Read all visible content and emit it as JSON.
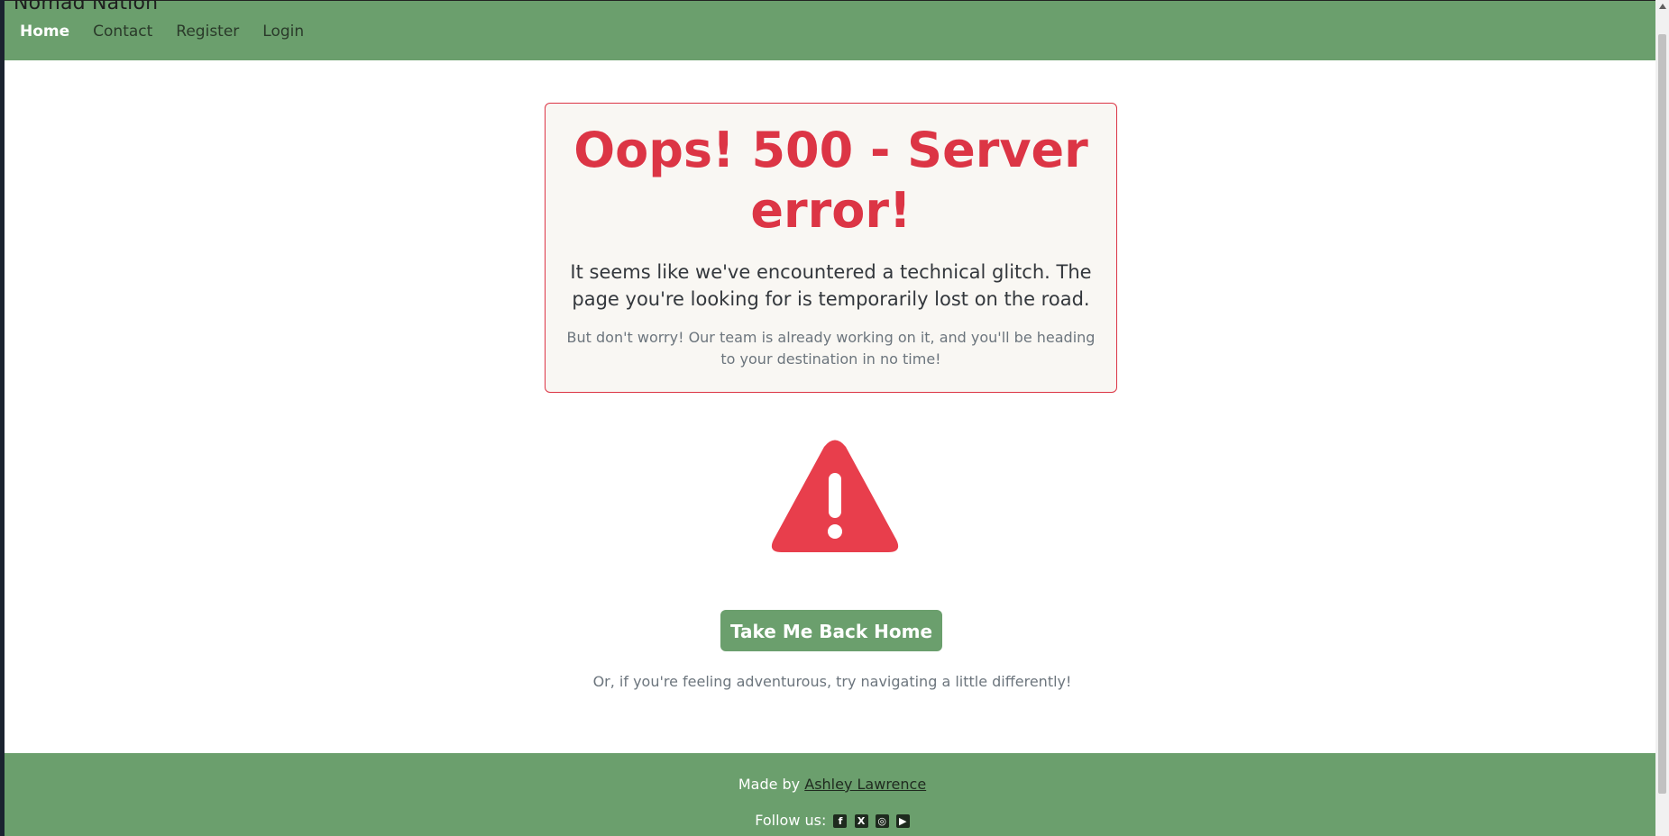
{
  "brand": "Nomad Nation",
  "nav": {
    "items": [
      {
        "label": "Home",
        "active": true
      },
      {
        "label": "Contact",
        "active": false
      },
      {
        "label": "Register",
        "active": false
      },
      {
        "label": "Login",
        "active": false
      }
    ]
  },
  "error_card": {
    "title": "Oops! 500 - Server error!",
    "lead": "It seems like we've encountered a technical glitch. The page you're looking for is temporarily lost on the road.",
    "sub": "But don't worry! Our team is already working on it, and you'll be heading to your destination in no time!"
  },
  "warning_icon": "warning-triangle-icon",
  "home_button": "Take Me Back Home",
  "alt_text": "Or, if you're feeling adventurous, try navigating a little differently!",
  "footer": {
    "made_by_prefix": "Made by",
    "author": "Ashley Lawrence",
    "follow_label": "Follow us:",
    "social_icons": [
      "facebook-icon",
      "x-icon",
      "instagram-icon",
      "youtube-icon"
    ]
  },
  "colors": {
    "primary_green": "#6b9f6d",
    "danger": "#dc3545",
    "card_bg": "#f9f7f3"
  }
}
